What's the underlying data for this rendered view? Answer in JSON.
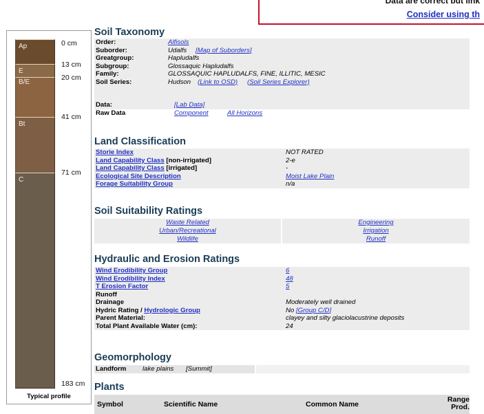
{
  "notice": {
    "line1": "Data are correct but link",
    "line2": "Consider using th"
  },
  "profile": {
    "caption": "Typical profile",
    "layers": [
      {
        "name": "Ap",
        "color": "#6b4b2e"
      },
      {
        "name": "E",
        "color": "#8a6a48"
      },
      {
        "name": "B/E",
        "color": "#8c6441"
      },
      {
        "name": "Bt",
        "color": "#7e5f45"
      },
      {
        "name": "C",
        "color": "#6b5d4c"
      }
    ],
    "depths": [
      "0 cm",
      "13 cm",
      "20 cm",
      "41 cm",
      "71 cm",
      "183 cm"
    ]
  },
  "soil_taxonomy": {
    "title": "Soil Taxonomy",
    "order_label": "Order:",
    "order_value": "Alfisols",
    "suborder_label": "Suborder:",
    "suborder_value": "Udalfs",
    "suborder_link": "[Map of Suborders]",
    "greatgroup_label": "Greatgroup:",
    "greatgroup_value": "Hapludalfs",
    "subgroup_label": "Subgroup:",
    "subgroup_value": "Glossaquic Hapludalfs",
    "family_label": "Family:",
    "family_value": "GLOSSAQUIC HAPLUDALFS, FINE, ILLITIC, MESIC",
    "series_label": "Soil Series:",
    "series_value": "Hudson",
    "series_link1": "(Link to OSD)",
    "series_link2": "(Soil Series Explorer)",
    "data_label": "Data:",
    "data_link": "[Lab Data]",
    "raw_label": "Raw Data",
    "raw_link1": "Component",
    "raw_link2": "All Horizons"
  },
  "land_classification": {
    "title": "Land Classification",
    "rows": [
      {
        "label_link": "Storie Index",
        "label_suffix": "",
        "value": "NOT RATED",
        "value_is_link": false
      },
      {
        "label_link": "Land Capability Class",
        "label_suffix": " [non-irrigated]",
        "value": "2-e",
        "value_is_link": false
      },
      {
        "label_link": "Land Capability Class",
        "label_suffix": " [irrigated]",
        "value": "-",
        "value_is_link": false
      },
      {
        "label_link": "Ecological Site Description",
        "label_suffix": "",
        "value": "Moist Lake Plain",
        "value_is_link": true
      },
      {
        "label_link": "Forage Suitability Group",
        "label_suffix": "",
        "value": "n/a",
        "value_is_link": false
      }
    ]
  },
  "suitability": {
    "title": "Soil Suitability Ratings",
    "rows": [
      {
        "left": "Waste Related",
        "right": "Engineering"
      },
      {
        "left": "Urban/Recreational",
        "right": "Irrigation"
      },
      {
        "left": "Wildlife",
        "right": "Runoff"
      }
    ]
  },
  "hydraulic": {
    "title": "Hydraulic and Erosion Ratings",
    "wind_group_label": "Wind Erodibility Group",
    "wind_group_value": "6",
    "wind_index_label": "Wind Erodibility Index",
    "wind_index_value": "48",
    "t_erosion_label": "T Erosion Factor",
    "t_erosion_value": "5",
    "runoff_label": "Runoff",
    "runoff_value": "",
    "drainage_label": "Drainage",
    "drainage_value": "Moderately well drained",
    "hydric_label_prefix": "Hydric Rating / ",
    "hydric_label_link": "Hydrologic Group",
    "hydric_value": "No",
    "hydric_value_link": "[Group C/D]",
    "parent_label": "Parent Material:",
    "parent_value": "clayey and silty glaciolacustrine deposits",
    "water_label": "Total Plant Available Water (cm):",
    "water_value": "24"
  },
  "geomorphology": {
    "title": "Geomorphology",
    "landform_label": "Landform",
    "landform_value": "lake plains",
    "landform_position": "[Summit]"
  },
  "plants": {
    "title": "Plants",
    "col_symbol": "Symbol",
    "col_scientific": "Scientific Name",
    "col_common": "Common Name",
    "col_range_1": "Range",
    "col_range_2": "Prod."
  }
}
